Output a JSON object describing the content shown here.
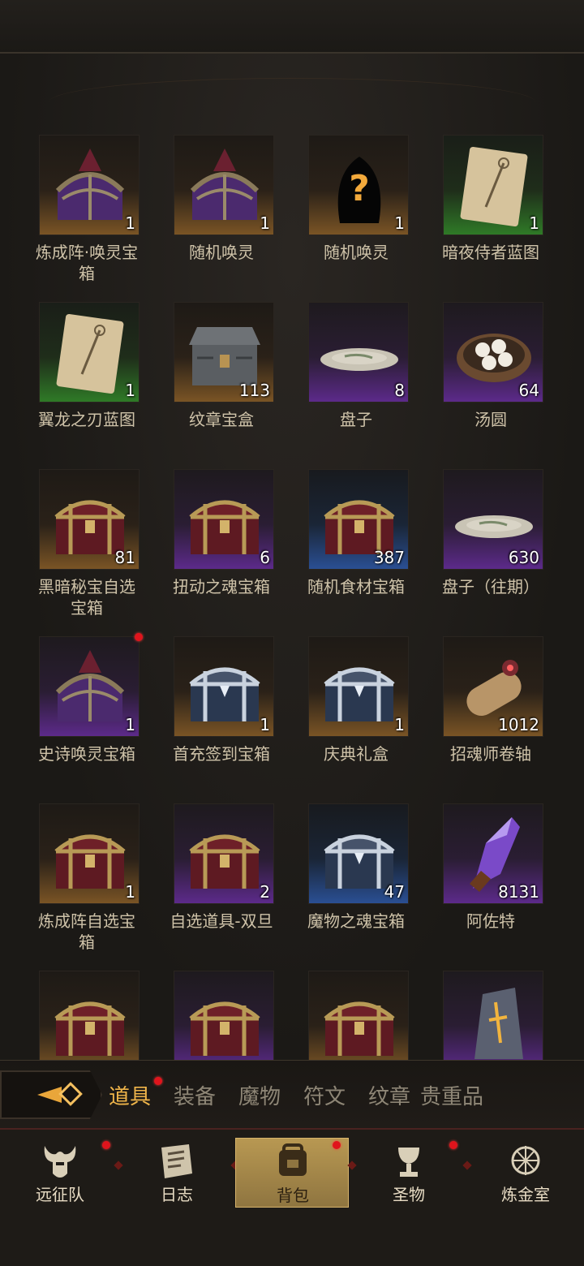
{
  "colors": {
    "rarity_orange": "#7a5425",
    "rarity_purple": "#5c2a8a",
    "rarity_green": "#2f7a27",
    "rarity_blue": "#2a4f93",
    "accent_gold": "#f0b54a",
    "notify_red": "#e0141c"
  },
  "items": [
    {
      "name": "炼成阵·唤灵宝箱",
      "count": "1",
      "rarity": "orange",
      "icon": "purple-spiked-chest-icon"
    },
    {
      "name": "随机唤灵",
      "count": "1",
      "rarity": "orange",
      "icon": "purple-spiked-chest-icon"
    },
    {
      "name": "随机唤灵",
      "count": "1",
      "rarity": "orange",
      "icon": "mystery-silhouette-icon"
    },
    {
      "name": "暗夜侍者蓝图",
      "count": "1",
      "rarity": "green",
      "icon": "blueprint-scroll-icon"
    },
    {
      "name": "翼龙之刃蓝图",
      "count": "1",
      "rarity": "green",
      "icon": "blueprint-scroll-icon"
    },
    {
      "name": "纹章宝盒",
      "count": "113",
      "rarity": "orange",
      "icon": "ornate-box-icon"
    },
    {
      "name": "盘子",
      "count": "8",
      "rarity": "purple",
      "icon": "plate-icon"
    },
    {
      "name": "汤圆",
      "count": "64",
      "rarity": "purple",
      "icon": "dumpling-bowl-icon"
    },
    {
      "name": "黑暗秘宝自选宝箱",
      "count": "81",
      "rarity": "orange",
      "icon": "red-gold-chest-icon"
    },
    {
      "name": "扭动之魂宝箱",
      "count": "6",
      "rarity": "purple",
      "icon": "red-gold-chest-icon"
    },
    {
      "name": "随机食材宝箱",
      "count": "387",
      "rarity": "blue",
      "icon": "red-gold-chest-icon"
    },
    {
      "name": "盘子（往期）",
      "count": "630",
      "rarity": "purple",
      "icon": "plate-icon"
    },
    {
      "name": "史诗唤灵宝箱",
      "count": "1",
      "rarity": "purple",
      "icon": "purple-spiked-chest-icon",
      "badge": true
    },
    {
      "name": "首充签到宝箱",
      "count": "1",
      "rarity": "orange",
      "icon": "silver-chest-icon"
    },
    {
      "name": "庆典礼盒",
      "count": "1",
      "rarity": "orange",
      "icon": "silver-chest-icon"
    },
    {
      "name": "招魂师卷轴",
      "count": "1012",
      "rarity": "orange",
      "icon": "rolled-scroll-icon"
    },
    {
      "name": "炼成阵自选宝箱",
      "count": "1",
      "rarity": "orange",
      "icon": "red-gold-chest-icon"
    },
    {
      "name": "自选道具-双旦",
      "count": "2",
      "rarity": "purple",
      "icon": "red-gold-chest-icon"
    },
    {
      "name": "魔物之魂宝箱",
      "count": "47",
      "rarity": "blue",
      "icon": "silver-chest-icon"
    },
    {
      "name": "阿佐特",
      "count": "8131",
      "rarity": "purple",
      "icon": "purple-crystal-icon"
    },
    {
      "name": "",
      "count": "",
      "rarity": "orange",
      "icon": "red-gold-chest-icon"
    },
    {
      "name": "",
      "count": "",
      "rarity": "purple",
      "icon": "red-gold-chest-icon"
    },
    {
      "name": "",
      "count": "",
      "rarity": "orange",
      "icon": "red-gold-chest-icon"
    },
    {
      "name": "",
      "count": "",
      "rarity": "purple",
      "icon": "rune-stone-icon"
    }
  ],
  "tabs": [
    {
      "label": "道具",
      "active": true,
      "badge": true
    },
    {
      "label": "装备"
    },
    {
      "label": "魔物"
    },
    {
      "label": "符文"
    },
    {
      "label": "纹章"
    },
    {
      "label": "贵重品"
    }
  ],
  "nav": [
    {
      "label": "远征队",
      "icon": "horned-helmet-icon",
      "badge": true
    },
    {
      "label": "日志",
      "icon": "journal-icon"
    },
    {
      "label": "背包",
      "icon": "backpack-icon",
      "active": true,
      "badge": true
    },
    {
      "label": "圣物",
      "icon": "chalice-icon",
      "badge": true
    },
    {
      "label": "炼金室",
      "icon": "alchemy-icon"
    }
  ]
}
